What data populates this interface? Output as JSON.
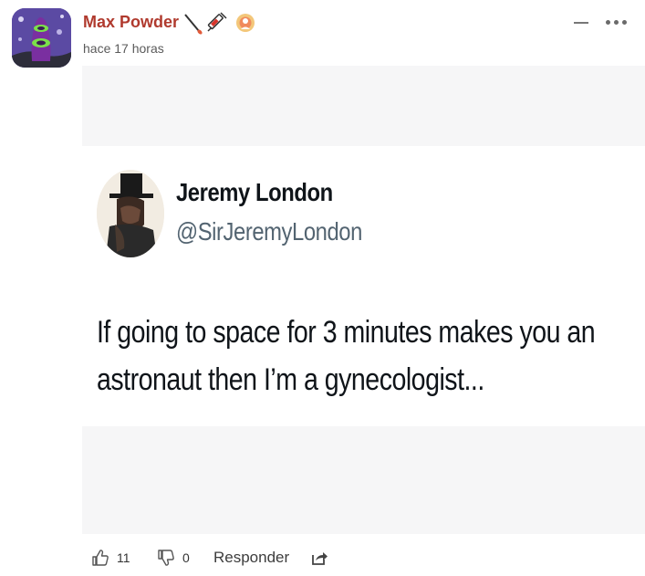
{
  "comment": {
    "author": "Max Powder",
    "timestamp": "hace 17 horas",
    "flair_icons": [
      "swab-icon",
      "syringe-icon",
      "award-badge-icon"
    ]
  },
  "tweet": {
    "name": "Jeremy London",
    "handle": "@SirJeremyLondon",
    "text": "If going to space for 3 minutes makes you an astronaut then I’m a gynecologist..."
  },
  "actions": {
    "likes": "11",
    "dislikes": "0",
    "reply_label": "Responder"
  },
  "colors": {
    "author": "#b03a2e",
    "timestamp": "#5b5b5b",
    "icon": "#555555"
  }
}
